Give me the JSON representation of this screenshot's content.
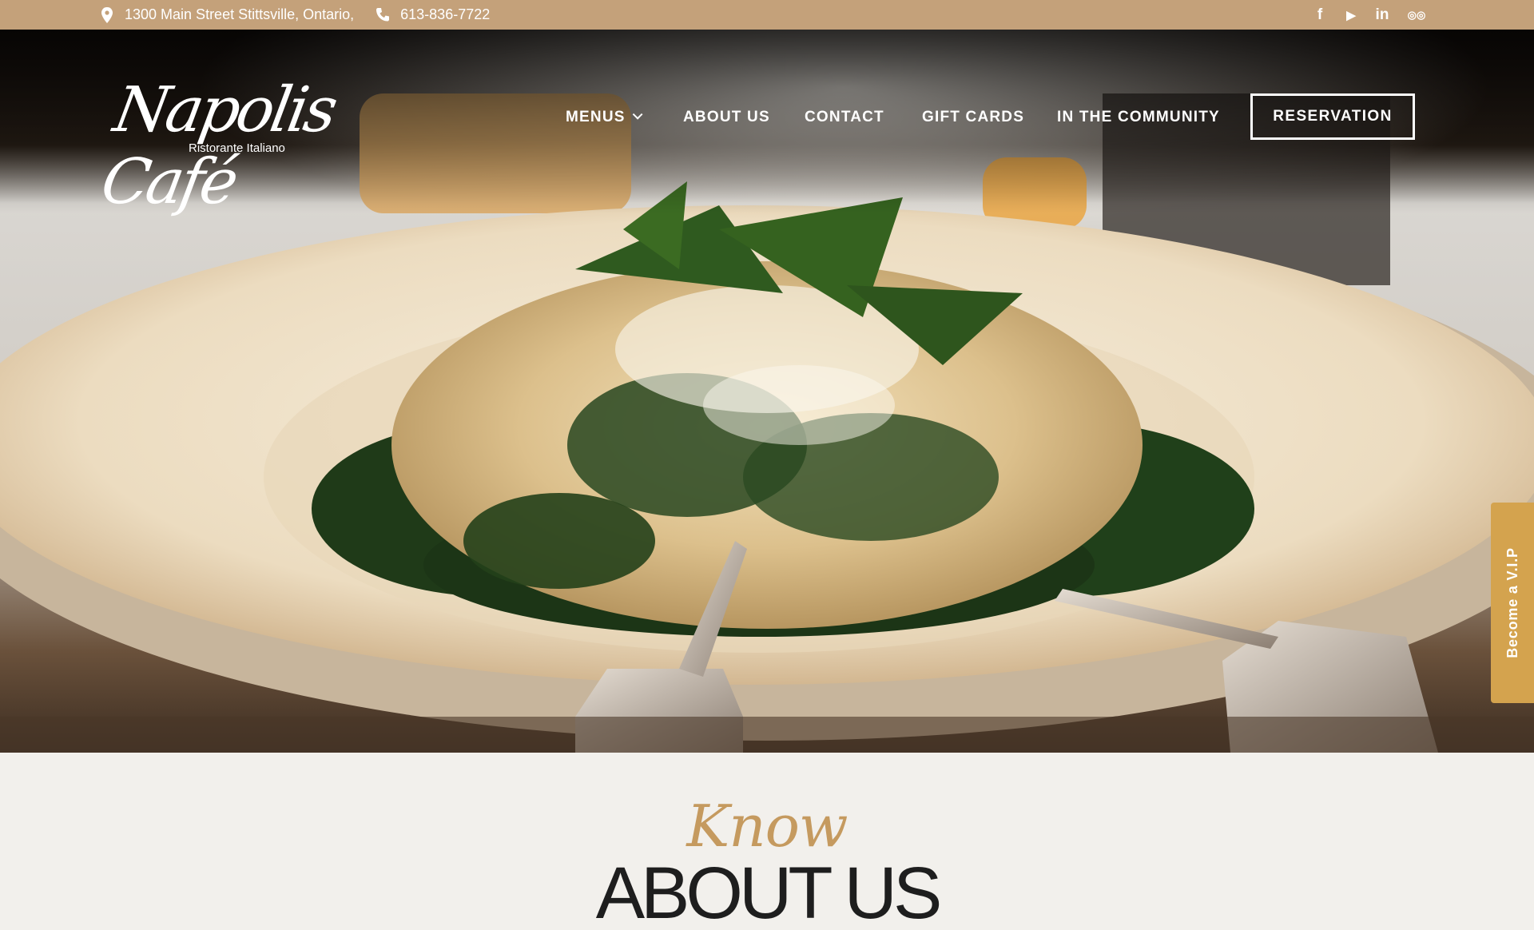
{
  "topbar": {
    "address": "1300 Main Street Stittsville, Ontario,",
    "phone": "613-836-7722",
    "social": [
      {
        "icon": "facebook-icon",
        "glyph": "f"
      },
      {
        "icon": "youtube-icon",
        "glyph": "▶"
      },
      {
        "icon": "linkedin-icon",
        "glyph": "in"
      },
      {
        "icon": "tripadvisor-icon",
        "glyph": "◎◎"
      }
    ]
  },
  "logo": {
    "name": "Napolis Café",
    "tagline": "Ristorante Italiano"
  },
  "nav": {
    "menus": "MENUS",
    "about": "ABOUT US",
    "contact": "CONTACT",
    "gift_cards": "GIFT CARDS",
    "community": "IN THE COMMUNITY",
    "reservation": "RESERVATION"
  },
  "vip_tab": "Become a V.I.P",
  "about": {
    "kicker": "Know",
    "heading": "ABOUT US"
  },
  "colors": {
    "topbar": "#c4a17a",
    "accent": "#c59a5f",
    "vip": "#d4a34e"
  }
}
